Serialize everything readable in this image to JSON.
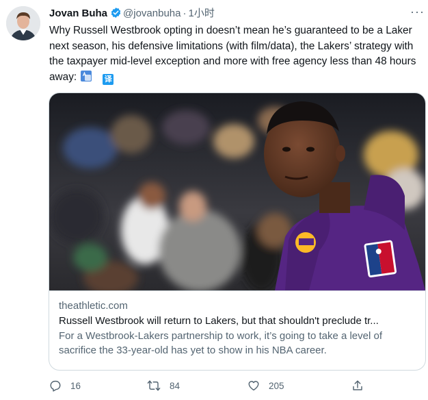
{
  "tweet": {
    "display_name": "Jovan Buha",
    "handle": "@jovanbuha",
    "separator": "·",
    "time": "1小时",
    "more": "···",
    "text": "Why Russell Westbrook opting in doesn’t mean he’s guaranteed to be a Laker next season, his defensive limitations (with film/data), the Lakers’ strategy with the taxpayer mid-level exception and more with free agency less than 48 hours away:",
    "translate_label": "译"
  },
  "card": {
    "domain": "theathletic.com",
    "title": "Russell Westbrook will return to Lakers, but that shouldn't preclude tr...",
    "description": "For a Westbrook-Lakers partnership to work, it’s going to take a level of sacrifice the 33-year-old has yet to show in his NBA career."
  },
  "actions": {
    "replies": "16",
    "retweets": "84",
    "likes": "205"
  },
  "colors": {
    "text": "#0f1419",
    "secondary": "#536471",
    "verified": "#1d9bf0",
    "jersey_purple": "#552583",
    "jersey_gold": "#fdb927"
  }
}
